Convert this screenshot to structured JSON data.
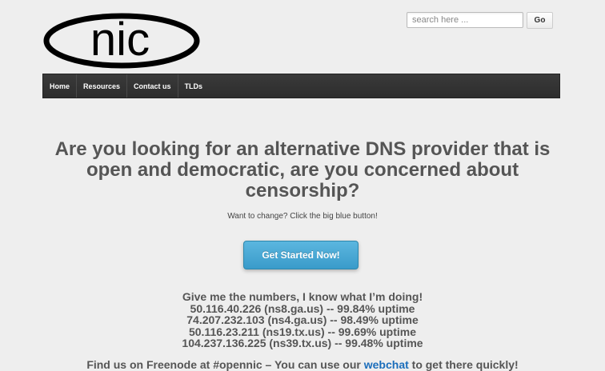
{
  "header": {
    "logo_text": "nic",
    "search": {
      "placeholder": "search here ...",
      "value": ""
    },
    "go_label": "Go"
  },
  "nav": {
    "items": [
      {
        "label": "Home"
      },
      {
        "label": "Resources"
      },
      {
        "label": "Contact us"
      },
      {
        "label": "TLDs"
      }
    ]
  },
  "main": {
    "headline": "Are you looking for an alternative DNS provider that is open and democratic, are you concerned about censorship?",
    "subtext": "Want to change? Click the big blue button!",
    "cta_label": "Get Started Now!",
    "numbers_intro": "Give me the numbers, I know what I’m doing!",
    "servers": [
      {
        "line": "50.116.40.226 (ns8.ga.us) -- 99.84% uptime"
      },
      {
        "line": "74.207.232.103 (ns4.ga.us) -- 98.49% uptime"
      },
      {
        "line": "50.116.23.211 (ns19.tx.us) -- 99.69% uptime"
      },
      {
        "line": "104.237.136.225 (ns39.tx.us) -- 99.48% uptime"
      }
    ],
    "footer_before": "Find us on Freenode at #opennic – You can use our ",
    "footer_link": "webchat",
    "footer_after": " to get there quickly!"
  },
  "colors": {
    "background": "#eeeeee",
    "navbar": "#333333",
    "cta": "#4aa8d4",
    "link": "#1a6dbb"
  }
}
